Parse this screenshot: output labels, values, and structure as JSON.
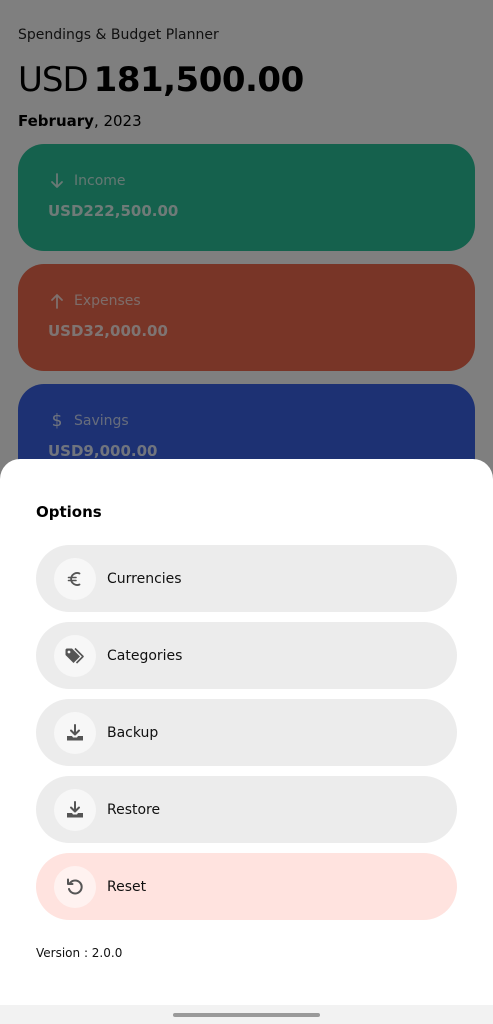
{
  "app": {
    "title": "Spendings & Budget Planner"
  },
  "balance": {
    "currency": "USD",
    "amount": "181,500.00"
  },
  "period": {
    "month": "February",
    "year": ", 2023"
  },
  "cards": {
    "income": {
      "label": "Income",
      "value": "USD222,500.00",
      "icon": "arrow-down-icon",
      "color": "#2bc29a"
    },
    "expenses": {
      "label": "Expenses",
      "value": "USD32,000.00",
      "icon": "arrow-up-icon",
      "color": "#f06a4f"
    },
    "savings": {
      "label": "Savings",
      "value": "USD9,000.00",
      "icon": "dollar-icon",
      "color": "#3a63e6"
    }
  },
  "options": {
    "title": "Options",
    "items": [
      {
        "label": "Currencies",
        "icon": "euro-icon"
      },
      {
        "label": "Categories",
        "icon": "tags-icon"
      },
      {
        "label": "Backup",
        "icon": "download-tray-icon"
      },
      {
        "label": "Restore",
        "icon": "download-tray-icon"
      },
      {
        "label": "Reset",
        "icon": "undo-icon",
        "color": "#ffe3df"
      }
    ],
    "version": "Version : 2.0.0"
  }
}
